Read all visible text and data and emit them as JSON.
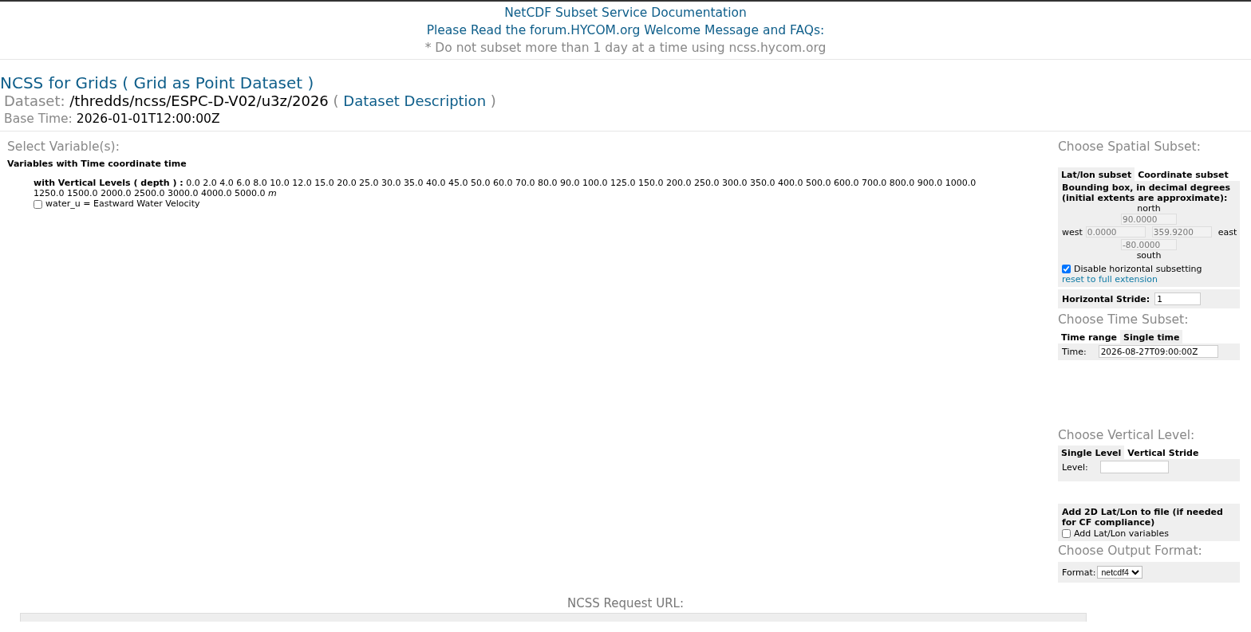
{
  "header": {
    "doc_link": "NetCDF Subset Service Documentation",
    "forum_link": "Please Read the forum.HYCOM.org Welcome Message and FAQs:",
    "notice": "* Do not subset more than 1 day at a time using ncss.hycom.org"
  },
  "title": "NCSS for Grids ( Grid as Point Dataset )",
  "dataset": {
    "label": "Dataset:",
    "path": "/thredds/ncss/ESPC-D-V02/u3z/2026",
    "open": "(",
    "link": "Dataset Description",
    "close": ")"
  },
  "base_time": {
    "label": "Base Time:",
    "value": "2026-01-01T12:00:00Z"
  },
  "variables": {
    "heading": "Select Variable(s):",
    "group_title": "Variables with Time coordinate time",
    "levels": "**with Vertical Levels ( depth ) :** 0.0 2.0 4.0 6.0 8.0 10.0 12.0 15.0 20.0 25.0 30.0 35.0 40.0 45.0 50.0 60.0 70.0 80.0 90.0 100.0 125.0 150.0 200.0 250.0 300.0 350.0 400.0 500.0 600.0 700.0 800.0 900.0 1000.0 1250.0 1500.0 2000.0 2500.0 3000.0 4000.0 5000.0 *m*",
    "items": [
      {
        "label": "water_u = Eastward Water Velocity",
        "checked": false
      }
    ]
  },
  "spatial": {
    "heading": "Choose Spatial Subset:",
    "tabs": [
      {
        "label": "Lat/lon subset",
        "selected": true
      },
      {
        "label": "Coordinate subset",
        "selected": false
      }
    ],
    "bbox_title": "Bounding box, in decimal degrees (initial extents are approximate):",
    "north_label": "north",
    "north": "90.0000",
    "west_label": "west",
    "west": "0.0000",
    "east": "359.9200",
    "east_label": "east",
    "south": "-80.0000",
    "south_label": "south",
    "disable": {
      "label": "Disable horizontal subsetting",
      "checked": true
    },
    "reset_link": "reset to full extension",
    "stride": {
      "label": "Horizontal Stride:",
      "value": "1"
    }
  },
  "time": {
    "heading": "Choose Time Subset:",
    "tabs": [
      {
        "label": "Time range",
        "selected": false
      },
      {
        "label": "Single time",
        "selected": true
      }
    ],
    "field": {
      "label": "Time:",
      "value": "2026-08-27T09:00:00Z"
    }
  },
  "vertical": {
    "heading": "Choose Vertical Level:",
    "tabs": [
      {
        "label": "Single Level",
        "selected": true
      },
      {
        "label": "Vertical Stride",
        "selected": false
      }
    ],
    "field": {
      "label": "Level:"
    }
  },
  "latlon": {
    "title": "Add 2D Lat/Lon to file (if needed for CF compliance)",
    "checkbox": {
      "label": "Add Lat/Lon variables",
      "checked": false
    }
  },
  "output": {
    "heading": "Choose Output Format:",
    "format": {
      "label": "Format:",
      "value": "netcdf4"
    }
  },
  "request": {
    "label": "NCSS Request URL:"
  }
}
